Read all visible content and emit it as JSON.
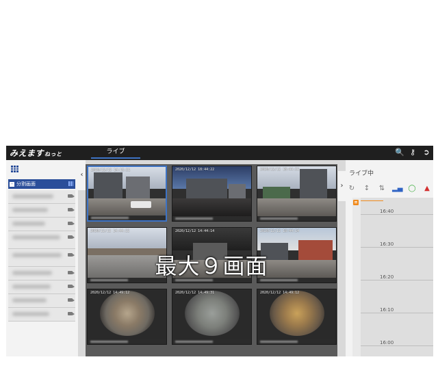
{
  "topbar": {
    "brand": "みえます",
    "brand_suffix": "ねっと",
    "tab_live": "ライブ",
    "icons": [
      "search-document-icon",
      "key-icon",
      "logout-icon"
    ]
  },
  "left_panel": {
    "split_label": "分割画面",
    "cameras": [
      "",
      "",
      "",
      "",
      "",
      "",
      "",
      "",
      ""
    ]
  },
  "feeds": [
    {
      "timestamp": "2020/12/12 14:15:31"
    },
    {
      "timestamp": "2020/12/12 18:44:22"
    },
    {
      "timestamp": "2020/12/12 18:44:31"
    },
    {
      "timestamp": "2020/12/12 14:44:22"
    },
    {
      "timestamp": "2020/12/12 14:44:14"
    },
    {
      "timestamp": "2020/12/12 18:44:14"
    },
    {
      "timestamp": "2020/12/12 14:49:12"
    },
    {
      "timestamp": "2020/12/12 14:49:31"
    },
    {
      "timestamp": "2020/12/12 14:49:12"
    }
  ],
  "overlay_caption": "最大９画面",
  "right_panel": {
    "status": "ライブ中",
    "icons": [
      "refresh-icon",
      "height-adjust-icon",
      "vertical-arrows-icon",
      "signal-icon",
      "bulb-icon",
      "warning-icon"
    ],
    "timeline_labels": [
      "16:40",
      "16:30",
      "16:20",
      "16:10",
      "16:00"
    ]
  },
  "colors": {
    "accent": "#2a4e9a",
    "tab_underline": "#3d73c5",
    "timeline_marker": "#f08a1c",
    "warning": "#d32f2f",
    "bulb": "#3fae3f"
  }
}
